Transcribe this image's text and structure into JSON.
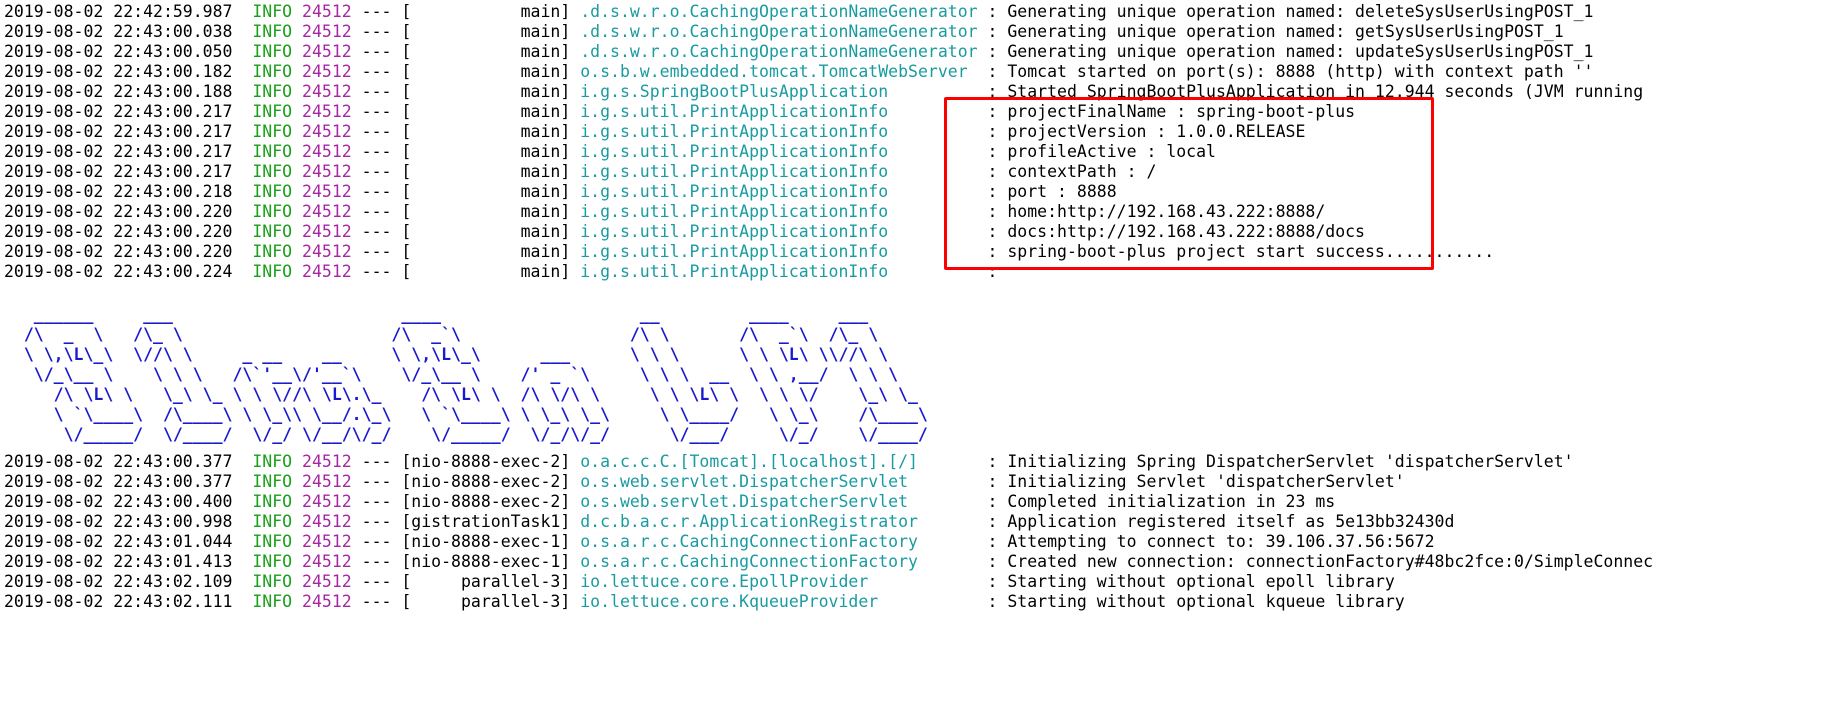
{
  "console": {
    "background": "#ffffff",
    "colors": {
      "timestamp": "#000000",
      "level_info": "#18a018",
      "pid": "#a626a4",
      "thread": "#000000",
      "logger": "#1a9ba1",
      "message": "#000000",
      "banner": "#1a1acd",
      "highlight_box": "#ff0000"
    }
  },
  "highlight": {
    "label": "project-startup-info-highlight"
  },
  "log_top": [
    {
      "ts": "2019-08-02 22:42:59.987",
      "level": "INFO",
      "pid": "24512",
      "dashes": "---",
      "thread": "main",
      "logger": ".d.s.w.r.o.CachingOperationNameGenerator",
      "message": "Generating unique operation named: deleteSysUserUsingPOST_1"
    },
    {
      "ts": "2019-08-02 22:43:00.038",
      "level": "INFO",
      "pid": "24512",
      "dashes": "---",
      "thread": "main",
      "logger": ".d.s.w.r.o.CachingOperationNameGenerator",
      "message": "Generating unique operation named: getSysUserUsingPOST_1"
    },
    {
      "ts": "2019-08-02 22:43:00.050",
      "level": "INFO",
      "pid": "24512",
      "dashes": "---",
      "thread": "main",
      "logger": ".d.s.w.r.o.CachingOperationNameGenerator",
      "message": "Generating unique operation named: updateSysUserUsingPOST_1"
    },
    {
      "ts": "2019-08-02 22:43:00.182",
      "level": "INFO",
      "pid": "24512",
      "dashes": "---",
      "thread": "main",
      "logger": "o.s.b.w.embedded.tomcat.TomcatWebServer",
      "message": "Tomcat started on port(s): 8888 (http) with context path ''"
    },
    {
      "ts": "2019-08-02 22:43:00.188",
      "level": "INFO",
      "pid": "24512",
      "dashes": "---",
      "thread": "main",
      "logger": "i.g.s.SpringBootPlusApplication",
      "message": "Started SpringBootPlusApplication in 12.944 seconds (JVM running"
    },
    {
      "ts": "2019-08-02 22:43:00.217",
      "level": "INFO",
      "pid": "24512",
      "dashes": "---",
      "thread": "main",
      "logger": "i.g.s.util.PrintApplicationInfo",
      "message": "projectFinalName : spring-boot-plus"
    },
    {
      "ts": "2019-08-02 22:43:00.217",
      "level": "INFO",
      "pid": "24512",
      "dashes": "---",
      "thread": "main",
      "logger": "i.g.s.util.PrintApplicationInfo",
      "message": "projectVersion : 1.0.0.RELEASE"
    },
    {
      "ts": "2019-08-02 22:43:00.217",
      "level": "INFO",
      "pid": "24512",
      "dashes": "---",
      "thread": "main",
      "logger": "i.g.s.util.PrintApplicationInfo",
      "message": "profileActive : local"
    },
    {
      "ts": "2019-08-02 22:43:00.217",
      "level": "INFO",
      "pid": "24512",
      "dashes": "---",
      "thread": "main",
      "logger": "i.g.s.util.PrintApplicationInfo",
      "message": "contextPath : /"
    },
    {
      "ts": "2019-08-02 22:43:00.218",
      "level": "INFO",
      "pid": "24512",
      "dashes": "---",
      "thread": "main",
      "logger": "i.g.s.util.PrintApplicationInfo",
      "message": "port : 8888"
    },
    {
      "ts": "2019-08-02 22:43:00.220",
      "level": "INFO",
      "pid": "24512",
      "dashes": "---",
      "thread": "main",
      "logger": "i.g.s.util.PrintApplicationInfo",
      "message": "home:http://192.168.43.222:8888/"
    },
    {
      "ts": "2019-08-02 22:43:00.220",
      "level": "INFO",
      "pid": "24512",
      "dashes": "---",
      "thread": "main",
      "logger": "i.g.s.util.PrintApplicationInfo",
      "message": "docs:http://192.168.43.222:8888/docs"
    },
    {
      "ts": "2019-08-02 22:43:00.220",
      "level": "INFO",
      "pid": "24512",
      "dashes": "---",
      "thread": "main",
      "logger": "i.g.s.util.PrintApplicationInfo",
      "message": "spring-boot-plus project start success..........."
    },
    {
      "ts": "2019-08-02 22:43:00.224",
      "level": "INFO",
      "pid": "24512",
      "dashes": "---",
      "thread": "main",
      "logger": "i.g.s.util.PrintApplicationInfo",
      "message": ""
    }
  ],
  "banner": {
    "name": "spring-boot-plus-ascii-banner",
    "text": "   ______     ___                       ____                    __         ____     ___\n  /\\  _  \\   /\\_ \\                     /\\  _`\\                 /\\ \\       /\\  _`\\  /\\_ \\\n  \\ \\,\\L\\_\\  \\//\\ \\     _ __    __     \\ \\,\\L\\_\\      ___      \\ \\ \\      \\ \\ \\L\\ \\\\//\\ \\\n   \\/_\\__ \\    \\ \\ \\   /\\`'__\\/'__`\\    \\/_\\__ \\    /' _ `\\     \\ \\ \\  __  \\ \\ ,__/  \\ \\ \\\n     /\\ \\L\\ \\   \\_\\ \\_ \\ \\ \\//\\ \\L\\.\\_    /\\ \\L\\ \\  /\\ \\/\\ \\     \\ \\ \\L\\ \\  \\ \\ \\/    \\_\\ \\_\n     \\ `\\____\\  /\\____\\ \\ \\_\\\\ \\__/.\\_\\   \\ `\\____\\ \\ \\_\\ \\_\\     \\ \\____/   \\ \\_\\    /\\____\\\n      \\/_____/  \\/____/  \\/_/ \\/__/\\/_/    \\/_____/  \\/_/\\/_/      \\/___/     \\/_/    \\/____/"
  },
  "log_bottom": [
    {
      "ts": "2019-08-02 22:43:00.377",
      "level": "INFO",
      "pid": "24512",
      "dashes": "---",
      "thread": "nio-8888-exec-2",
      "logger": "o.a.c.c.C.[Tomcat].[localhost].[/]",
      "message": "Initializing Spring DispatcherServlet 'dispatcherServlet'"
    },
    {
      "ts": "2019-08-02 22:43:00.377",
      "level": "INFO",
      "pid": "24512",
      "dashes": "---",
      "thread": "nio-8888-exec-2",
      "logger": "o.s.web.servlet.DispatcherServlet",
      "message": "Initializing Servlet 'dispatcherServlet'"
    },
    {
      "ts": "2019-08-02 22:43:00.400",
      "level": "INFO",
      "pid": "24512",
      "dashes": "---",
      "thread": "nio-8888-exec-2",
      "logger": "o.s.web.servlet.DispatcherServlet",
      "message": "Completed initialization in 23 ms"
    },
    {
      "ts": "2019-08-02 22:43:00.998",
      "level": "INFO",
      "pid": "24512",
      "dashes": "---",
      "thread": "gistrationTask1",
      "logger": "d.c.b.a.c.r.ApplicationRegistrator",
      "message": "Application registered itself as 5e13bb32430d"
    },
    {
      "ts": "2019-08-02 22:43:01.044",
      "level": "INFO",
      "pid": "24512",
      "dashes": "---",
      "thread": "nio-8888-exec-1",
      "logger": "o.s.a.r.c.CachingConnectionFactory",
      "message": "Attempting to connect to: 39.106.37.56:5672"
    },
    {
      "ts": "2019-08-02 22:43:01.413",
      "level": "INFO",
      "pid": "24512",
      "dashes": "---",
      "thread": "nio-8888-exec-1",
      "logger": "o.s.a.r.c.CachingConnectionFactory",
      "message": "Created new connection: connectionFactory#48bc2fce:0/SimpleConnec"
    },
    {
      "ts": "2019-08-02 22:43:02.109",
      "level": "INFO",
      "pid": "24512",
      "dashes": "---",
      "thread": "parallel-3",
      "logger": "io.lettuce.core.EpollProvider",
      "message": "Starting without optional epoll library"
    },
    {
      "ts": "2019-08-02 22:43:02.111",
      "level": "INFO",
      "pid": "24512",
      "dashes": "---",
      "thread": "parallel-3",
      "logger": "io.lettuce.core.KqueueProvider",
      "message": "Starting without optional kqueue library"
    }
  ]
}
